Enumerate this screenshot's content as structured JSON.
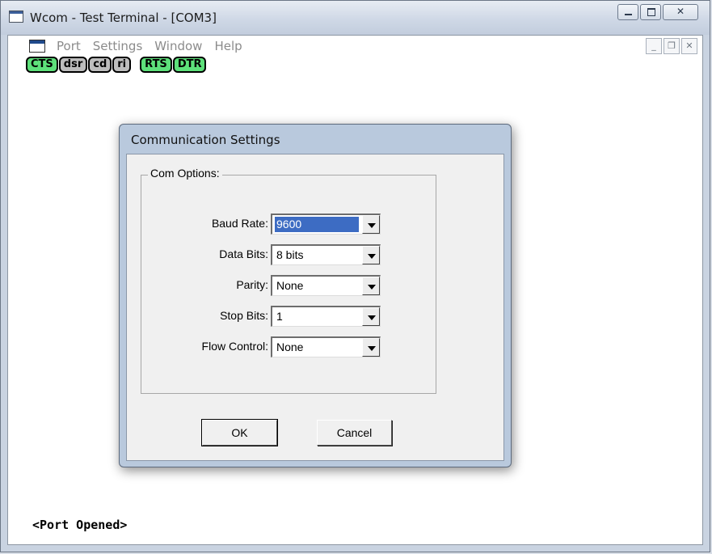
{
  "window": {
    "title": "Wcom - Test Terminal - [COM3]"
  },
  "menu": {
    "items": [
      "Port",
      "Settings",
      "Window",
      "Help"
    ]
  },
  "signals": [
    {
      "label": "CTS",
      "state": "on"
    },
    {
      "label": "dsr",
      "state": "off"
    },
    {
      "label": "cd",
      "state": "off"
    },
    {
      "label": "ri",
      "state": "off"
    },
    {
      "label": "RTS",
      "state": "on"
    },
    {
      "label": "DTR",
      "state": "on"
    }
  ],
  "terminal": {
    "status_line": "<Port Opened>"
  },
  "dialog": {
    "title": "Communication Settings",
    "group_label": "Com Options:",
    "fields": [
      {
        "label": "Baud Rate:",
        "value": "9600"
      },
      {
        "label": "Data Bits:",
        "value": "8 bits"
      },
      {
        "label": "Parity:",
        "value": "None"
      },
      {
        "label": "Stop Bits:",
        "value": "1"
      },
      {
        "label": "Flow Control:",
        "value": "None"
      }
    ],
    "ok_label": "OK",
    "cancel_label": "Cancel"
  },
  "colors": {
    "signal_on": "#5de07a",
    "signal_off": "#bdbdbd",
    "selection": "#3d6cc3"
  }
}
